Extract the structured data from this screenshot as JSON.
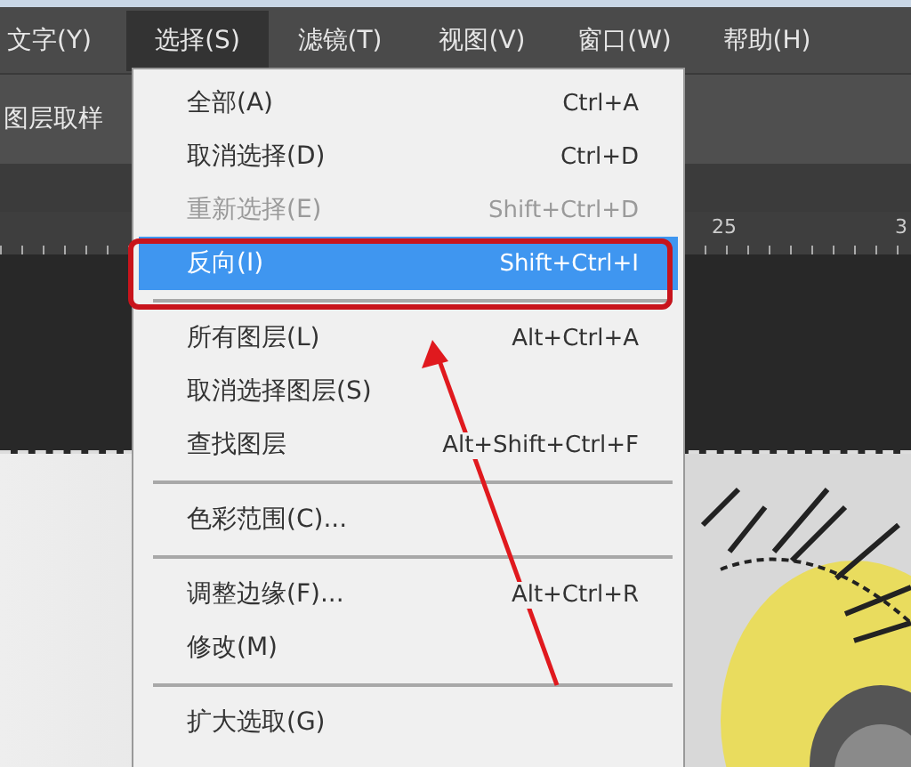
{
  "menubar": [
    {
      "label": "文字(Y)",
      "selected": false
    },
    {
      "label": "选择(S)",
      "selected": true
    },
    {
      "label": "滤镜(T)",
      "selected": false
    },
    {
      "label": "视图(V)",
      "selected": false
    },
    {
      "label": "窗口(W)",
      "selected": false
    },
    {
      "label": "帮助(H)",
      "selected": false
    }
  ],
  "options_bar": {
    "label": "图层取样"
  },
  "ruler": {
    "labels": [
      "25",
      "3"
    ]
  },
  "menu": {
    "items": [
      {
        "kind": "item",
        "label": "全部(A)",
        "shortcut": "Ctrl+A",
        "disabled": false,
        "selected": false
      },
      {
        "kind": "item",
        "label": "取消选择(D)",
        "shortcut": "Ctrl+D",
        "disabled": false,
        "selected": false
      },
      {
        "kind": "item",
        "label": "重新选择(E)",
        "shortcut": "Shift+Ctrl+D",
        "disabled": true,
        "selected": false
      },
      {
        "kind": "item",
        "label": "反向(I)",
        "shortcut": "Shift+Ctrl+I",
        "disabled": false,
        "selected": true
      },
      {
        "kind": "separator"
      },
      {
        "kind": "item",
        "label": "所有图层(L)",
        "shortcut": "Alt+Ctrl+A",
        "disabled": false,
        "selected": false
      },
      {
        "kind": "item",
        "label": "取消选择图层(S)",
        "disabled": false,
        "selected": false
      },
      {
        "kind": "item",
        "label": "查找图层",
        "shortcut": "Alt+Shift+Ctrl+F",
        "disabled": false,
        "selected": false
      },
      {
        "kind": "separator"
      },
      {
        "kind": "item",
        "label": "色彩范围(C)...",
        "disabled": false,
        "selected": false
      },
      {
        "kind": "separator"
      },
      {
        "kind": "item",
        "label": "调整边缘(F)...",
        "shortcut": "Alt+Ctrl+R",
        "disabled": false,
        "selected": false
      },
      {
        "kind": "item",
        "label": "修改(M)",
        "disabled": false,
        "selected": false
      },
      {
        "kind": "separator"
      },
      {
        "kind": "item",
        "label": "扩大选取(G)",
        "disabled": false,
        "selected": false
      }
    ]
  }
}
